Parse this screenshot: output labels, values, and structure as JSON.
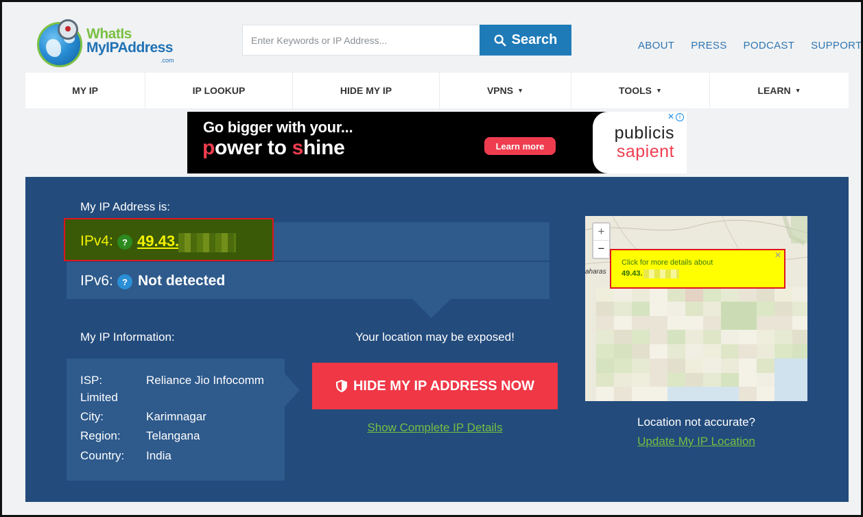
{
  "header": {
    "logo_line1": "WhatIs",
    "logo_line2": "MyIPAddress",
    "logo_suffix": ".com",
    "search_placeholder": "Enter Keywords or IP Address...",
    "search_button": "Search",
    "links": [
      "ABOUT",
      "PRESS",
      "PODCAST",
      "SUPPORT"
    ]
  },
  "nav": {
    "items": [
      {
        "label": "MY IP",
        "dropdown": false
      },
      {
        "label": "IP LOOKUP",
        "dropdown": false
      },
      {
        "label": "HIDE MY IP",
        "dropdown": false
      },
      {
        "label": "VPNS",
        "dropdown": true
      },
      {
        "label": "TOOLS",
        "dropdown": true
      },
      {
        "label": "LEARN",
        "dropdown": true
      }
    ],
    "caret": "▼"
  },
  "ad": {
    "line1": "Go bigger with your...",
    "line2_parts": [
      "p",
      "ower to ",
      "s",
      "hine"
    ],
    "button": "Learn more",
    "brand1": "publicis",
    "brand2": "sapient",
    "info": "i",
    "close": "✕"
  },
  "main": {
    "my_ip_label": "My IP Address is:",
    "ipv4_label": "IPv4:",
    "ipv4_value": "49.43.",
    "ipv6_label": "IPv6:",
    "ipv6_value": "Not detected",
    "help_mark": "?",
    "info_title": "My IP Information:",
    "info": {
      "isp_label": "ISP:",
      "isp_value": "Reliance Jio Infocomm",
      "isp_value_cont": "Limited",
      "city_label": "City:",
      "city_value": "Karimnagar",
      "region_label": "Region:",
      "region_value": "Telangana",
      "country_label": "Country:",
      "country_value": "India"
    },
    "exposed_text": "Your location may be exposed!",
    "hide_button": "HIDE MY IP ADDRESS NOW",
    "show_details_link": "Show Complete IP Details",
    "map_tip_line1": "Click for more details about",
    "map_tip_ip": "49.43.",
    "map_tip_close": "✕",
    "map_town": "aharas",
    "zoom_in": "+",
    "zoom_out": "−",
    "location_question": "Location not accurate?",
    "update_location_link": "Update My IP Location"
  },
  "colors": {
    "panel": "#234b7c",
    "band": "#2e5a8c",
    "accent_red": "#f03746",
    "link_green": "#72c043",
    "search_blue": "#1f7bb8"
  }
}
